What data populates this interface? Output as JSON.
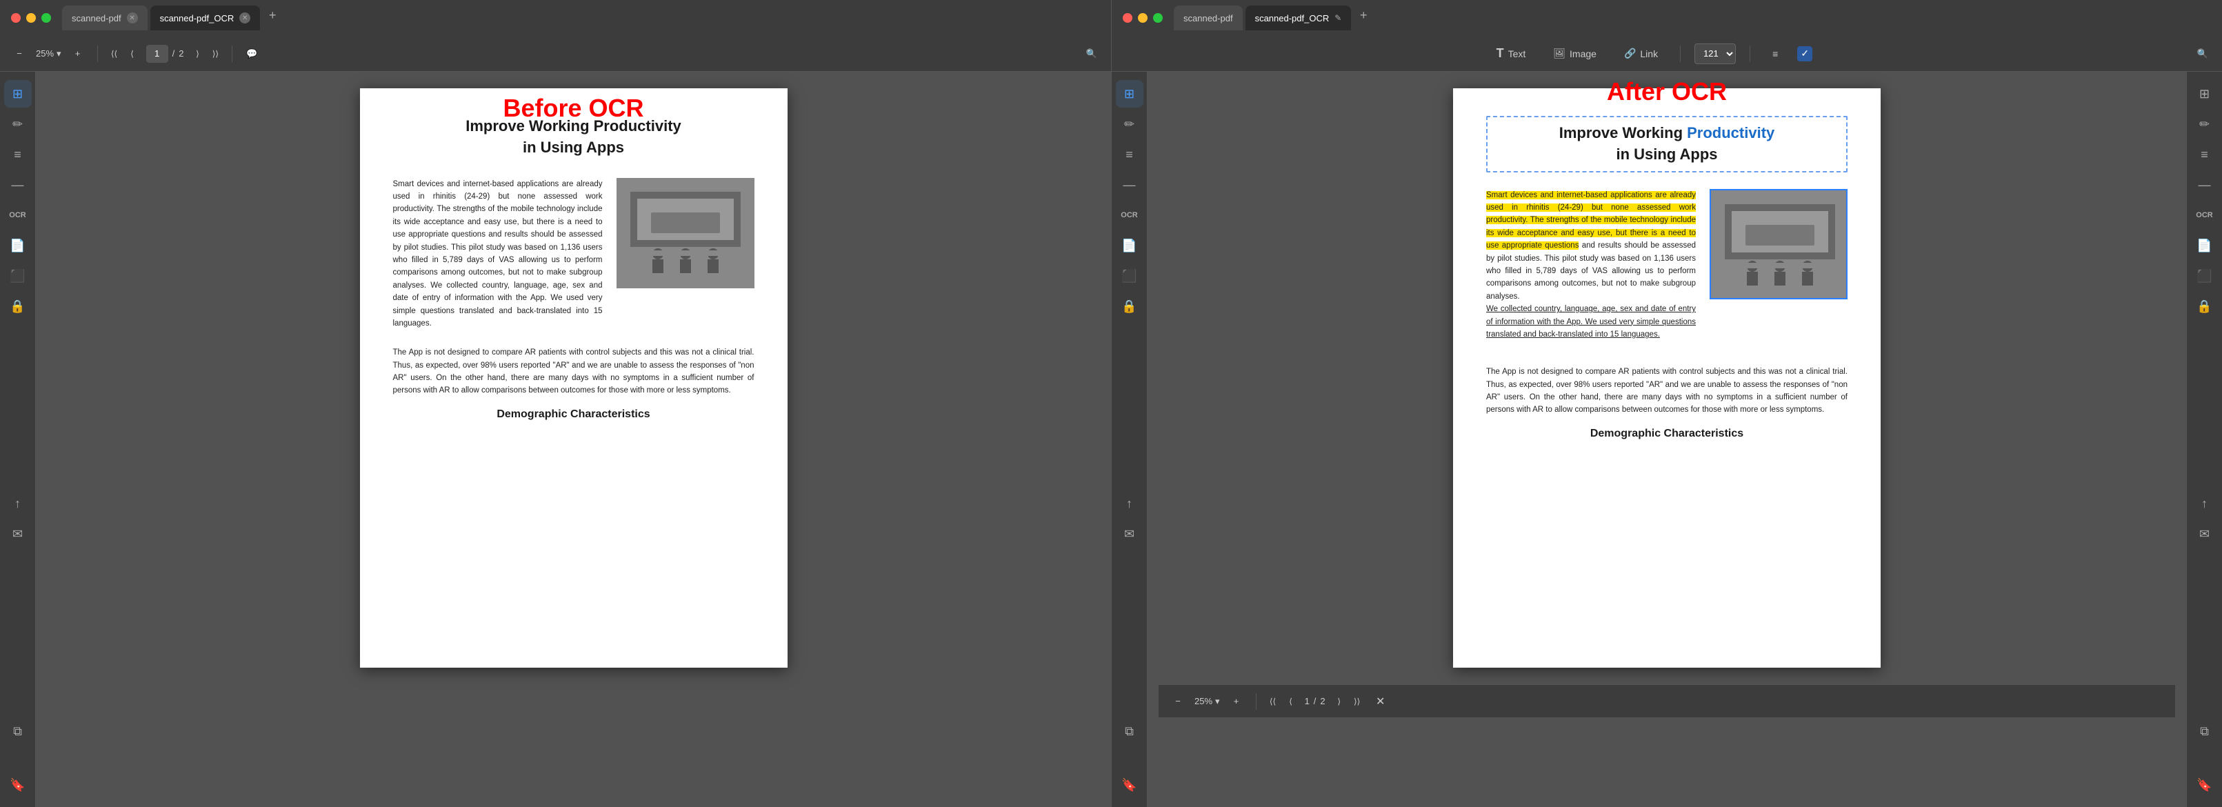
{
  "window_left": {
    "title": "scanned-pdf",
    "tab1": {
      "label": "scanned-pdf"
    },
    "tab2": {
      "label": "scanned-pdf_OCR"
    },
    "toolbar": {
      "zoom_minus": "−",
      "zoom_value": "25%",
      "zoom_plus": "+",
      "nav_first": "⟨⟨",
      "nav_prev": "⟨",
      "page_current": "1",
      "page_sep": "/",
      "page_total": "2",
      "nav_next": "⟩",
      "nav_last": "⟩⟩",
      "comment_icon": "💬",
      "search_icon": "🔍"
    },
    "overlay_label": "Before OCR",
    "pdf": {
      "title_line1": "Improve Working Productivity",
      "title_line2": "in Using Apps",
      "body_para1": "Smart devices and internet-based applications are already used in rhinitis (24-29) but none assessed work productivity. The strengths of the mobile technology include its wide acceptance and easy use, but there is a need to use appropriate questions and results should be assessed by pilot studies. This pilot study was based on 1,136 users who filled in 5,789 days of VAS allowing us to perform comparisons among outcomes, but not to make subgroup analyses. We collected country, language, age, sex and date of entry of information with the App. We used very simple questions translated and back-translated into 15 languages.",
      "body_para2": "The App is not designed to compare AR patients with control subjects and this was not a clinical trial. Thus, as expected, over 98% users reported \"AR\" and we are unable to assess the responses of \"non AR\" users. On the other hand, there are many days with no symptoms in a sufficient number of persons with AR to allow comparisons between outcomes for those with more or less symptoms.",
      "section_title": "Demographic Characteristics"
    },
    "sidebar": {
      "icon1": "📋",
      "icon2": "✏️",
      "icon3": "📝",
      "icon4": "—",
      "icon5": "🗂️",
      "icon6": "📋",
      "icon7": "📁",
      "icon8": "💬",
      "icon_bottom1": "🔧",
      "icon_bottom2": "🔖"
    }
  },
  "window_right": {
    "title": "scanned-pdf_OCR",
    "tab1": {
      "label": "scanned-pdf"
    },
    "tab2": {
      "label": "scanned-pdf_OCR"
    },
    "overlay_label": "After OCR",
    "ocr_toolbar": {
      "text_icon": "T",
      "text_label": "Text",
      "image_icon": "🖼",
      "image_label": "Image",
      "link_icon": "🔗",
      "link_label": "Link",
      "font_size": "121",
      "align_icon": "≡",
      "checkbox_checked": "✓"
    },
    "pdf": {
      "title_line1_part1": "Improve Working ",
      "title_line1_part2": "Productivity",
      "title_line2": "in Using Apps",
      "body_para1_highlighted": "Smart devices and internet-based applications are already used in rhinitis (24-29) but none assessed work productivity. The strengths of the mobile technology include its wide acceptance and easy use, but there is a need to use appropriate questions",
      "body_para1_normal": " and results should be assessed by pilot studies. This pilot study was based on 1,136 users who filled in 5,789 days of VAS allowing us to perform comparisons among outcomes, but not to make subgroup analyses.",
      "body_para1_underline": "We collected country, language, age, sex and date of entry of information with the App. We used very simple questions translated and back-translated into 15 languages.",
      "body_para2": "The App is not designed to compare AR patients with control subjects and this was not a clinical trial. Thus, as expected, over 98% users reported \"AR\" and we are unable to assess the responses of \"non AR\" users. On the other hand, there are many days with no symptoms in a sufficient number of persons with AR to allow comparisons between outcomes for those with more or less symptoms.",
      "section_title": "Demographic Characteristics"
    },
    "bottom_toolbar": {
      "zoom_minus": "−",
      "zoom_value": "25%",
      "zoom_chevron": "▾",
      "zoom_plus": "+",
      "nav_first": "⟨⟨",
      "nav_prev": "⟨",
      "page_current": "1",
      "page_sep": "/",
      "page_total": "2",
      "nav_next": "⟩",
      "nav_last": "⟩⟩",
      "close": "✕"
    },
    "sidebar": {
      "icon1": "📋",
      "icon2": "✏️",
      "icon3": "📝",
      "icon4": "—",
      "icon5": "🗂️",
      "icon6": "📋",
      "icon7": "📁",
      "icon8": "💬",
      "icon_bottom1": "🔧",
      "icon_bottom2": "🔖"
    }
  }
}
